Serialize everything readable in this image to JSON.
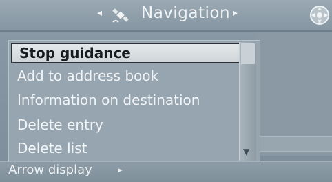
{
  "header": {
    "title": "Navigation",
    "left_arrow": "◂",
    "right_arrow": "▸"
  },
  "menu": {
    "items": [
      {
        "label": "Stop guidance",
        "selected": true
      },
      {
        "label": "Add to address book"
      },
      {
        "label": "Information on destination"
      },
      {
        "label": "Delete entry"
      },
      {
        "label": "Delete list"
      }
    ],
    "scroll_down_glyph": "▼"
  },
  "footer": {
    "label": "Arrow display",
    "arrow": "▸"
  },
  "colors": {
    "panel": "#96a5af",
    "selection": "#e4e8ea",
    "text": "#f2f5f7"
  }
}
